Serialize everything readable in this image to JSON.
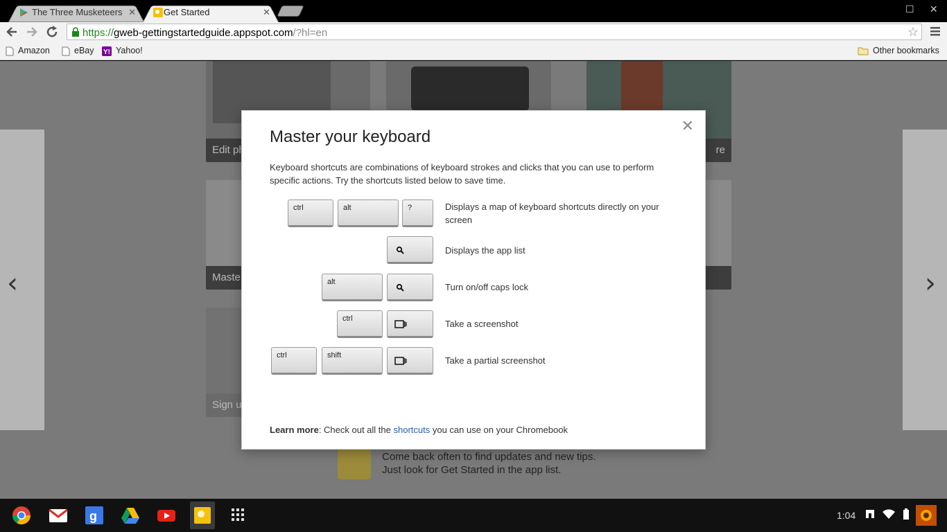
{
  "tabs": [
    {
      "title": "The Three Musketeers - ",
      "active": false
    },
    {
      "title": "Get Started",
      "active": true
    }
  ],
  "toolbar": {
    "url_scheme": "https://",
    "url_host": "gweb-gettingstartedguide.appspot.com",
    "url_rest": "/?hl=en"
  },
  "bookmarks": {
    "items": [
      "Amazon",
      "eBay",
      "Yahoo!"
    ],
    "other": "Other bookmarks"
  },
  "page": {
    "cards": [
      "Edit ph",
      "re",
      "Maste",
      "Sign u"
    ],
    "footer_line1": "Come back often to find updates and new tips.",
    "footer_line2": "Just look for Get Started in the app list."
  },
  "modal": {
    "title": "Master your keyboard",
    "intro": "Keyboard shortcuts are combinations of keyboard strokes and clicks that you can use to perform specific actions. Try the shortcuts listed below to save time.",
    "shortcuts": [
      {
        "keys": [
          "ctrl",
          "alt",
          "?"
        ],
        "description": "Displays a map of keyboard shortcuts directly on your screen"
      },
      {
        "keys": [
          "search"
        ],
        "description": "Displays the app list"
      },
      {
        "keys": [
          "alt",
          "search"
        ],
        "description": "Turn on/off caps lock"
      },
      {
        "keys": [
          "ctrl",
          "window-switcher"
        ],
        "description": "Take a screenshot"
      },
      {
        "keys": [
          "ctrl",
          "shift",
          "window-switcher"
        ],
        "description": "Take a partial screenshot"
      }
    ],
    "learn_more_label": "Learn more",
    "learn_more_pre": ": Check out all the ",
    "learn_more_link": "shortcuts",
    "learn_more_post": " you can use on your Chromebook"
  },
  "shelf": {
    "apps": [
      "chrome-icon",
      "gmail-icon",
      "google-search-icon",
      "drive-icon",
      "youtube-icon",
      "get-started-icon",
      "app-launcher-icon"
    ],
    "time": "1:04"
  }
}
